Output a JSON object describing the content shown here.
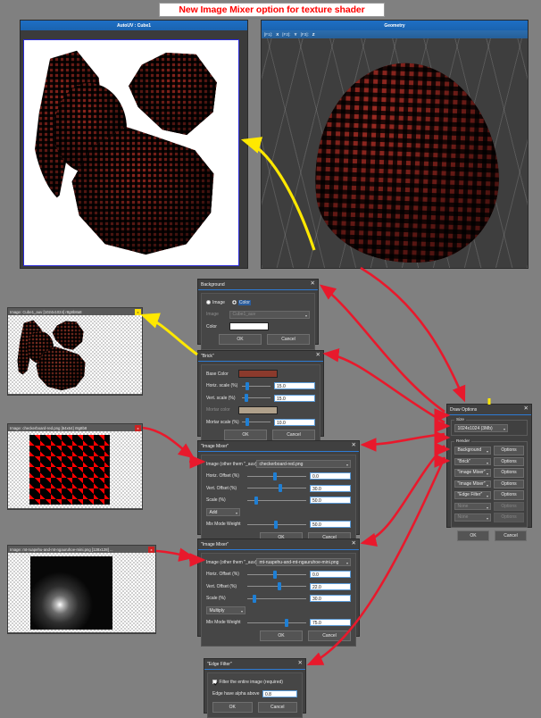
{
  "banner": {
    "text": "New Image Mixer  option for texture shader"
  },
  "autouv_window": {
    "title": "AutoUV : Cube1"
  },
  "geometry_window": {
    "title": "Geometry",
    "axes": [
      {
        "key": "[F1]:",
        "axis": "X"
      },
      {
        "key": "[F2]:",
        "axis": "Y"
      },
      {
        "key": "[F3]:",
        "axis": "Z"
      }
    ]
  },
  "image_panels": [
    {
      "title": "Image: Cube1_auv [1024x1024] r8g8b8a8",
      "close": "x"
    },
    {
      "title": "Image: checkerboard-red.png [64x64] r8g8b8",
      "close": "x"
    },
    {
      "title": "Image: mt-ruapehu-and-mt-ngauruhoe-mini.png [128x128] ...",
      "close": "x"
    }
  ],
  "dialog_background": {
    "title": "Background",
    "close": "✕",
    "radio_image": "Image",
    "radio_color": "Color",
    "image_label": "Image",
    "image_value": "Cube1_auv",
    "color_label": "Color",
    "color_value": "#ffffff",
    "ok": "OK",
    "cancel": "Cancel"
  },
  "dialog_brick": {
    "title": "\"Brick\"",
    "close": "✕",
    "base_color_label": "Base Color",
    "base_color": "#8b3a2c",
    "rows": [
      {
        "label": "Horiz. scale (%)",
        "value": "15.0",
        "knob": 12
      },
      {
        "label": "Vert. scale (%)",
        "value": "15.0",
        "knob": 8
      },
      {
        "label": "Mortar scale (%)",
        "value": "10.0",
        "knob": 12
      }
    ],
    "mortar_color_label": "Mortar color",
    "mortar_color": "#b0a18b",
    "ok": "OK",
    "cancel": "Cancel"
  },
  "dialog_mixer_1": {
    "title": "\"Image Mixer\"",
    "close": "✕",
    "image_label": "Image (other them \"_auv)",
    "image_value": "checkerboard-red.png",
    "rows": [
      {
        "label": "Horiz. Offset (%)",
        "value": "0.0",
        "knob": 44
      },
      {
        "label": "Vert. Offset (%)",
        "value": "30.0",
        "knob": 53
      },
      {
        "label": "Scale (%)",
        "value": "50.0",
        "knob": 12
      }
    ],
    "mode": "Add",
    "weight_label": "Mix Mode Weight",
    "weight_value": "50.0",
    "weight_knob": 45,
    "ok": "OK",
    "cancel": "Cancel"
  },
  "dialog_mixer_2": {
    "title": "\"Image Mixer\"",
    "close": "✕",
    "image_label": "Image (other them \"_auv)",
    "image_value": "mt-ruapehu-and-mt-ngauruhoe-mini.png",
    "rows": [
      {
        "label": "Horiz. Offset (%)",
        "value": "0.0",
        "knob": 44
      },
      {
        "label": "Vert. Offset (%)",
        "value": "22.0",
        "knob": 51
      },
      {
        "label": "Scale (%)",
        "value": "30.0",
        "knob": 9
      }
    ],
    "mode": "Multiply",
    "weight_label": "Mix Mode Weight",
    "weight_value": "75.0",
    "weight_knob": 63,
    "ok": "OK",
    "cancel": "Cancel"
  },
  "dialog_edge_filter": {
    "title": "\"Edge Filter\"",
    "close": "✕",
    "checkbox_label": "Filter the entire image (required)",
    "alpha_label": "Edge have alpha above",
    "alpha_value": "0.8",
    "ok": "OK",
    "cancel": "Cancel"
  },
  "draw_options": {
    "title": "Draw Options",
    "close": "✕",
    "size_caption": "Size",
    "size_value": "1024x1024 (3Mb)",
    "render_caption": "Render",
    "options_label": "Options",
    "layers": [
      {
        "name": "Background",
        "enabled": true
      },
      {
        "name": "\"Brick\"",
        "enabled": true
      },
      {
        "name": "\"Image Mixer\"",
        "enabled": true
      },
      {
        "name": "\"Image Mixer\"",
        "enabled": true
      },
      {
        "name": "\"Edge Filter\"",
        "enabled": true
      },
      {
        "name": "None",
        "enabled": false
      },
      {
        "name": "None",
        "enabled": false
      }
    ],
    "ok": "OK",
    "cancel": "Cancel"
  },
  "colors": {
    "banner_text": "#ff0000",
    "titlebar": "#1565c0",
    "arrow_red": "#e8192c",
    "arrow_yellow": "#ffe800",
    "slider_knob": "#1f7fd4"
  }
}
